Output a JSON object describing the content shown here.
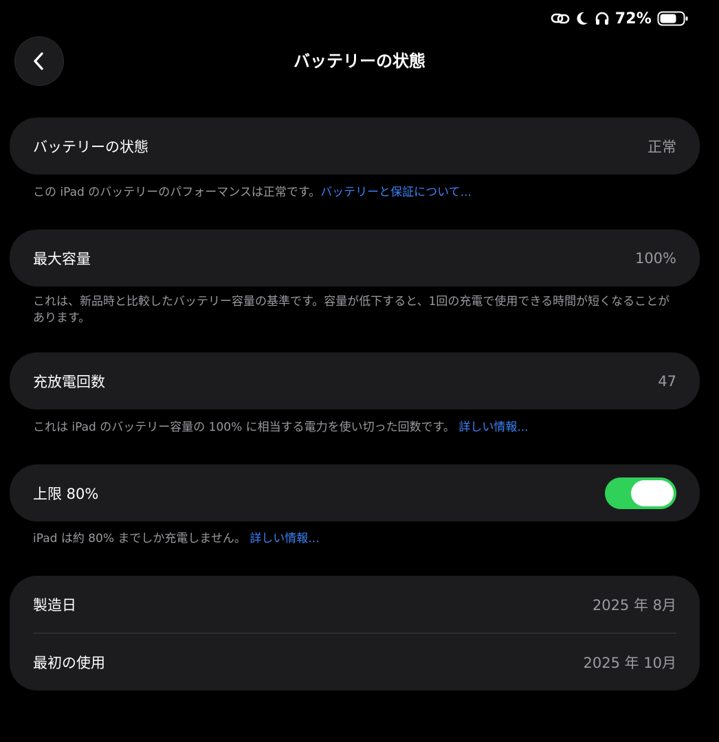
{
  "status_bar": {
    "battery_percent_text": "72%",
    "battery_level": 0.72,
    "icons": [
      "link-icon",
      "moon-icon",
      "headphones-icon",
      "battery-icon"
    ]
  },
  "header": {
    "title": "バッテリーの状態",
    "back_icon": "chevron-left-icon"
  },
  "battery_health": {
    "label": "バッテリーの状態",
    "value": "正常",
    "note_text": "この iPad のバッテリーのパフォーマンスは正常です。",
    "note_link": "バッテリーと保証について..."
  },
  "max_capacity": {
    "label": "最大容量",
    "value": "100%",
    "note_text": "これは、新品時と比較したバッテリー容量の基準です。容量が低下すると、1回の充電で使用できる時間が短くなることがあります。"
  },
  "cycle_count": {
    "label": "充放電回数",
    "value": "47",
    "note_text": "これは iPad のバッテリー容量の 100% に相当する電力を使い切った回数です。",
    "note_link": "詳しい情報..."
  },
  "limit_80": {
    "label": "上限 80%",
    "toggle_on": true,
    "note_text": "iPad は約 80% までしか充電しません。",
    "note_link": "詳しい情報..."
  },
  "dates": {
    "manufacture_label": "製造日",
    "manufacture_value": "2025 年 8月",
    "first_use_label": "最初の使用",
    "first_use_value": "2025 年 10月"
  },
  "colors": {
    "background": "#000000",
    "card": "#1c1c1e",
    "secondary_text": "#9a9aa0",
    "link": "#3b82f6",
    "toggle_on": "#30d158"
  }
}
